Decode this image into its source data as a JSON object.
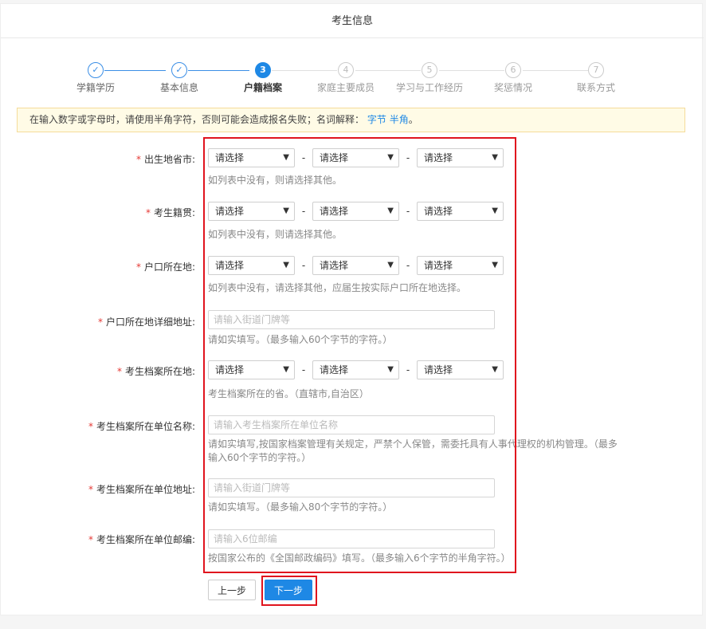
{
  "header": {
    "title": "考生信息"
  },
  "steps": [
    {
      "num": "✓",
      "label": "学籍学历",
      "state": "done"
    },
    {
      "num": "✓",
      "label": "基本信息",
      "state": "done"
    },
    {
      "num": "3",
      "label": "户籍档案",
      "state": "active"
    },
    {
      "num": "4",
      "label": "家庭主要成员",
      "state": "todo"
    },
    {
      "num": "5",
      "label": "学习与工作经历",
      "state": "todo"
    },
    {
      "num": "6",
      "label": "奖惩情况",
      "state": "todo"
    },
    {
      "num": "7",
      "label": "联系方式",
      "state": "todo"
    }
  ],
  "notice": {
    "text": "在输入数字或字母时，请使用半角字符，否则可能会造成报名失败；名词解释：",
    "link1": "字节",
    "link2": "半角",
    "suffix": "。"
  },
  "form": {
    "required_mark": "*",
    "select_placeholder": "请选择",
    "dash": "-",
    "birthplace": {
      "label": "出生地省市:",
      "hint": "如列表中没有，则请选择其他。"
    },
    "native_place": {
      "label": "考生籍贯:",
      "hint": "如列表中没有，则请选择其他。"
    },
    "hukou": {
      "label": "户口所在地:",
      "hint": "如列表中没有，请选择其他，应届生按实际户口所在地选择。"
    },
    "hukou_address": {
      "label": "户口所在地详细地址:",
      "placeholder": "请输入街道门牌等",
      "hint": "请如实填写。（最多输入60个字节的字符。）"
    },
    "archive_location": {
      "label": "考生档案所在地:",
      "hint": "考生档案所在的省。（直辖市,自治区）"
    },
    "archive_unit_name": {
      "label": "考生档案所在单位名称:",
      "placeholder": "请输入考生档案所在单位名称",
      "hint_line1": "请如实填写,按国家档案管理有关规定，严禁个人保管，需委托具有人事代理权的机构管理。（最多",
      "hint_line2": "输入60个字节的字符。）"
    },
    "archive_unit_address": {
      "label": "考生档案所在单位地址:",
      "placeholder": "请输入街道门牌等",
      "hint": "请如实填写。（最多输入80个字节的字符。）"
    },
    "archive_unit_postcode": {
      "label": "考生档案所在单位邮编:",
      "placeholder": "请输入6位邮编",
      "hint": "按国家公布的《全国邮政编码》填写。（最多输入6个字节的半角字符。）"
    }
  },
  "buttons": {
    "prev": "上一步",
    "next": "下一步"
  },
  "colors": {
    "accent": "#1e88e5",
    "required": "#e53935",
    "highlight_box": "#e0141e",
    "notice_bg": "#fffbe6"
  }
}
